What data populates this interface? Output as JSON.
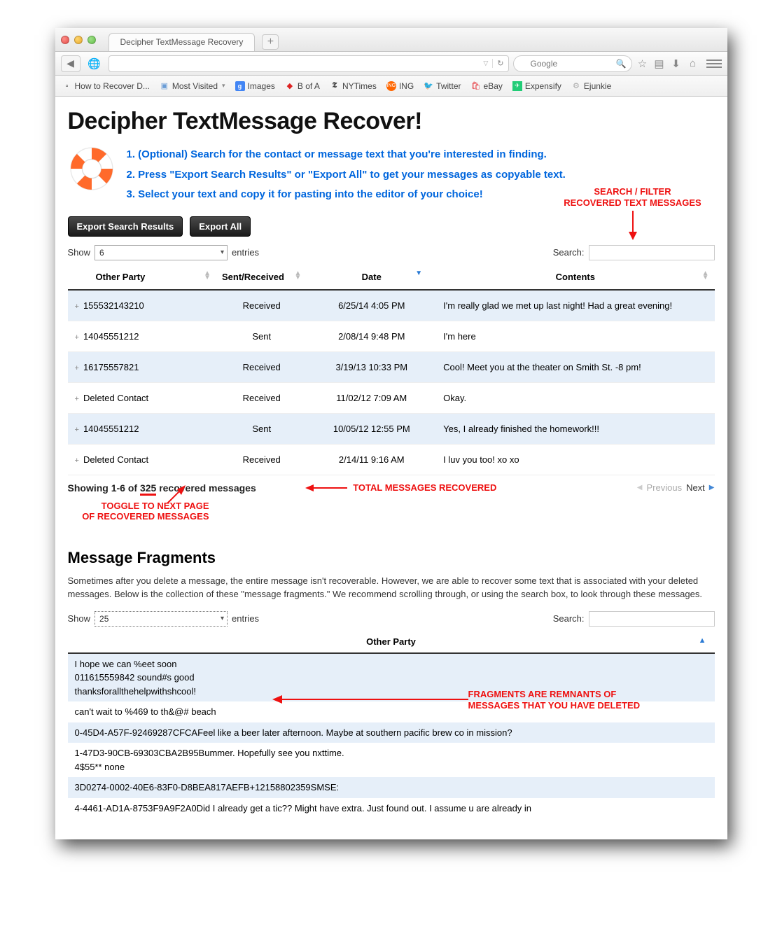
{
  "browser": {
    "tab_title": "Decipher TextMessage Recovery",
    "search_placeholder": "Google",
    "bookmarks": [
      {
        "label": "How to Recover D...",
        "icon": "page"
      },
      {
        "label": "Most Visited",
        "icon": "folder",
        "dropdown": true
      },
      {
        "label": "Images",
        "icon": "google"
      },
      {
        "label": "B of A",
        "icon": "bofa"
      },
      {
        "label": "NYTimes",
        "icon": "nyt"
      },
      {
        "label": "ING",
        "icon": "ing"
      },
      {
        "label": "Twitter",
        "icon": "twitter"
      },
      {
        "label": "eBay",
        "icon": "ebay"
      },
      {
        "label": "Expensify",
        "icon": "expensify"
      },
      {
        "label": "Ejunkie",
        "icon": "ejunkie"
      }
    ]
  },
  "page": {
    "title": "Decipher TextMessage Recover!",
    "step1": "1.  (Optional) Search for the contact or message text that you're interested in finding.",
    "step2": "2.  Press \"Export Search Results\" or \"Export All\" to get your messages as copyable text.",
    "step3": "3.  Select your text and copy it for pasting into the editor of your choice!",
    "export_search": "Export Search Results",
    "export_all": "Export All"
  },
  "messages_table": {
    "show_label": "Show",
    "show_value": "6",
    "entries_label": "entries",
    "search_label": "Search:",
    "columns": {
      "party": "Other Party",
      "dir": "Sent/Received",
      "date": "Date",
      "contents": "Contents"
    },
    "rows": [
      {
        "party": "155532143210",
        "dir": "Received",
        "date": "6/25/14  4:05 PM",
        "contents": "I'm really glad we met up last night! Had a great evening!"
      },
      {
        "party": "14045551212",
        "dir": "Sent",
        "date": "2/08/14  9:48 PM",
        "contents": "I'm here"
      },
      {
        "party": "16175557821",
        "dir": "Received",
        "date": "3/19/13 10:33 PM",
        "contents": "Cool! Meet you at the theater on Smith St. -8 pm!"
      },
      {
        "party": "Deleted Contact",
        "dir": "Received",
        "date": "11/02/12  7:09 AM",
        "contents": "Okay."
      },
      {
        "party": "14045551212",
        "dir": "Sent",
        "date": "10/05/12  12:55 PM",
        "contents": "Yes, I already finished the homework!!!"
      },
      {
        "party": "Deleted Contact",
        "dir": "Received",
        "date": "2/14/11  9:16 AM",
        "contents": "I luv you too! xo xo"
      }
    ],
    "info_prefix": "Showing 1-6 of ",
    "info_count": "325",
    "info_suffix": " recovered messages",
    "prev": "Previous",
    "next": "Next"
  },
  "fragments": {
    "heading": "Message Fragments",
    "description": "Sometimes after you delete a message, the entire message isn't recoverable. However, we are able to recover some text that is associated with your deleted messages. Below is the collection of these \"message fragments.\" We recommend scrolling through, or using the search box, to look through these messages.",
    "show_label": "Show",
    "show_value": "25",
    "entries_label": "entries",
    "search_label": "Search:",
    "column": "Other Party",
    "rows": [
      "I hope we can %eet soon\n011615559842    sound#s good\nthanksforallthehelpwithshcool!",
      "can't wait to %469 to th&@# beach",
      "0-45D4-A57F-92469287CFCAFeel like a beer later afternoon. Maybe at southern pacific brew co in mission?",
      "1-47D3-90CB-69303CBA2B95Bummer. Hopefully see you nxttime.\n4$55** none",
      "3D0274-0002-40E6-83F0-D8BEA817AEFB+12158802359SMSE:",
      "4-4461-AD1A-8753F9A9F2A0Did I already get a tic?? Might have extra. Just found out. I assume u are already in"
    ]
  },
  "annotations": {
    "search_filter_l1": "SEARCH / FILTER",
    "search_filter_l2": "RECOVERED TEXT MESSAGES",
    "total": "TOTAL MESSAGES RECOVERED",
    "toggle_l1": "TOGGLE TO NEXT PAGE",
    "toggle_l2": "OF RECOVERED MESSAGES",
    "fragments_l1": "FRAGMENTS ARE REMNANTS OF",
    "fragments_l2": "MESSAGES THAT YOU HAVE DELETED"
  }
}
